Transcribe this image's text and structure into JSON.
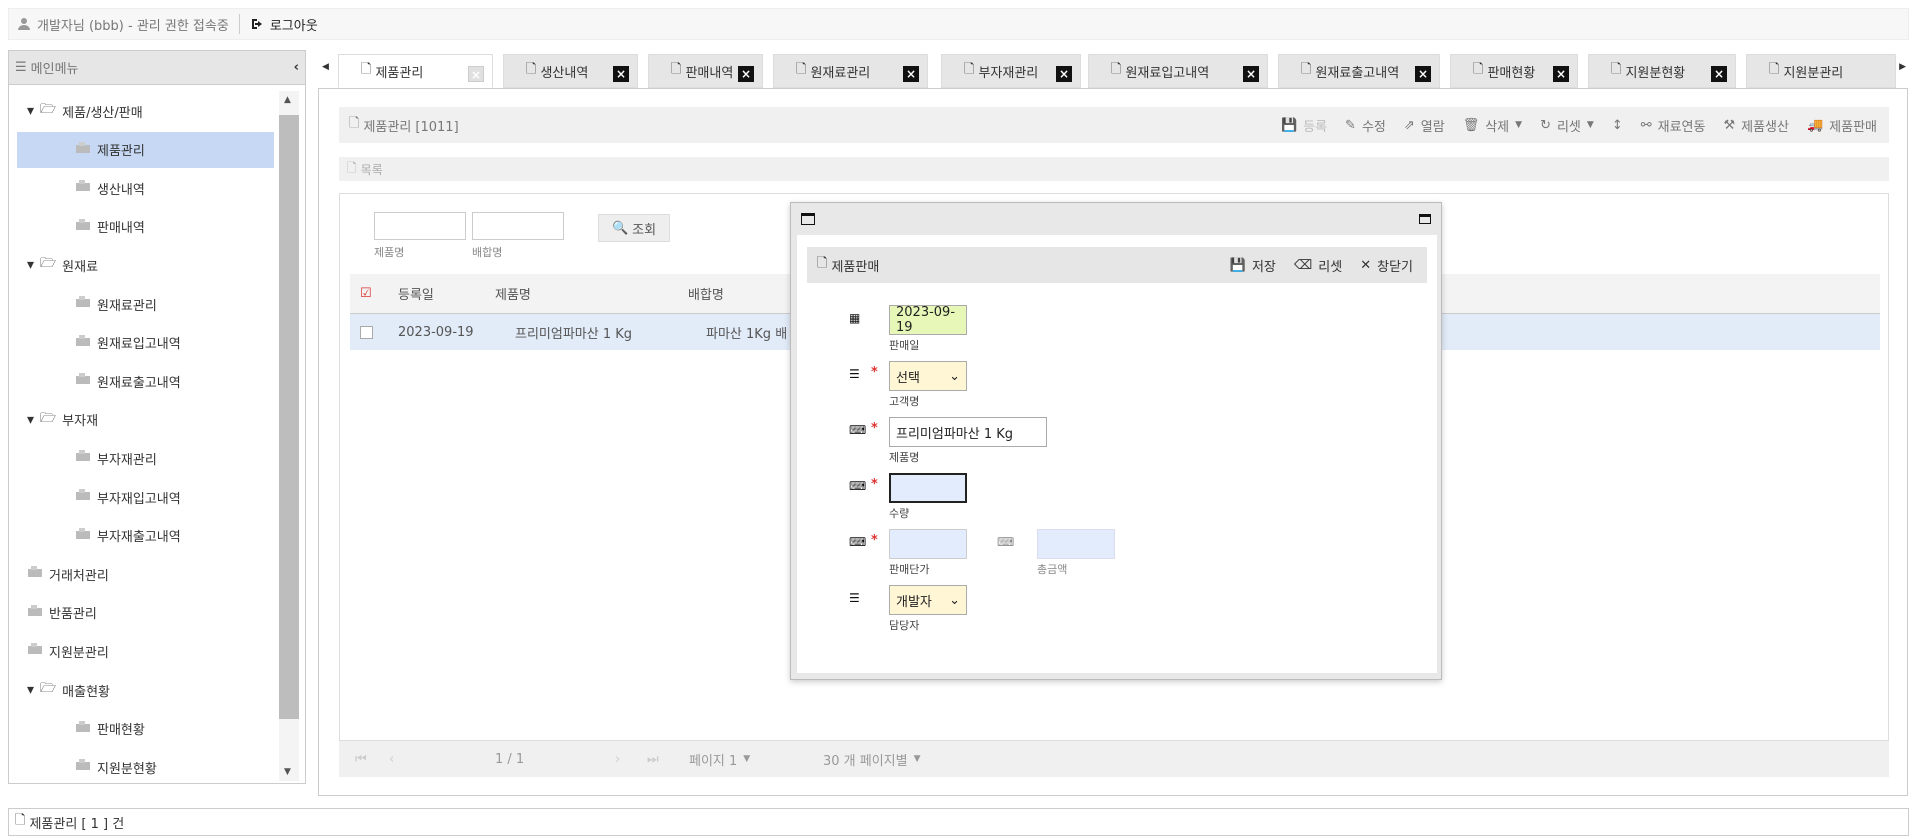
{
  "topbar": {
    "user_text": "개발자님 (bbb) - 관리 권한 접속중",
    "logout_label": "로그아웃"
  },
  "sidebar": {
    "title": "메인메뉴",
    "items": [
      {
        "label": "제품/생산/판매",
        "level": 0,
        "folder": true
      },
      {
        "label": "제품관리",
        "level": 1,
        "selected": true
      },
      {
        "label": "생산내역",
        "level": 1
      },
      {
        "label": "판매내역",
        "level": 1
      },
      {
        "label": "원재료",
        "level": 0,
        "folder": true
      },
      {
        "label": "원재료관리",
        "level": 1
      },
      {
        "label": "원재료입고내역",
        "level": 1
      },
      {
        "label": "원재료출고내역",
        "level": 1
      },
      {
        "label": "부자재",
        "level": 0,
        "folder": true
      },
      {
        "label": "부자재관리",
        "level": 1
      },
      {
        "label": "부자재입고내역",
        "level": 1
      },
      {
        "label": "부자재출고내역",
        "level": 1
      },
      {
        "label": "거래처관리",
        "level": 0
      },
      {
        "label": "반품관리",
        "level": 0
      },
      {
        "label": "지원분관리",
        "level": 0
      },
      {
        "label": "매출현황",
        "level": 0,
        "folder": true
      },
      {
        "label": "판매현황",
        "level": 1
      },
      {
        "label": "지원분현황",
        "level": 1
      }
    ]
  },
  "tabs": [
    {
      "label": "제품관리"
    },
    {
      "label": "생산내역"
    },
    {
      "label": "판매내역"
    },
    {
      "label": "원재료관리"
    },
    {
      "label": "부자재관리"
    },
    {
      "label": "원재료입고내역"
    },
    {
      "label": "원재료출고내역"
    },
    {
      "label": "판매현황"
    },
    {
      "label": "지원분현황"
    },
    {
      "label": "지원분관리"
    }
  ],
  "toolbar": {
    "title": "제품관리 [1011]",
    "buttons": {
      "register": "등록",
      "edit": "수정",
      "open": "열람",
      "delete": "삭제",
      "reset": "리셋",
      "material": "재료연동",
      "produce": "제품생산",
      "sell": "제품판매"
    }
  },
  "list": {
    "title": "목록"
  },
  "search": {
    "product_label": "제품명",
    "mix_label": "배합명",
    "button": "조회"
  },
  "grid": {
    "headers": {
      "date": "등록일",
      "product": "제품명",
      "mix": "배합명"
    },
    "rows": [
      {
        "date": "2023-09-19",
        "product": "프리미엄파마산 1 Kg",
        "mix": "파마산 1Kg 배"
      }
    ]
  },
  "pager": {
    "info": "1 / 1",
    "page": "페이지 1",
    "per_page": "30 개 페이지별"
  },
  "status": {
    "text": "제품관리 [ 1 ] 건"
  },
  "modal": {
    "title": "제품판매",
    "actions": {
      "save": "저장",
      "reset": "리셋",
      "close": "창닫기"
    },
    "fields": {
      "sale_date": {
        "value": "2023-09-19",
        "label": "판매일"
      },
      "customer": {
        "value": "선택",
        "label": "고객명"
      },
      "product": {
        "value": "프리미엄파마산 1 Kg",
        "label": "제품명"
      },
      "quantity": {
        "value": "",
        "label": "수량"
      },
      "unit_price": {
        "value": "",
        "label": "판매단가"
      },
      "total": {
        "value": "",
        "label": "총금액"
      },
      "manager": {
        "value": "개발자",
        "label": "담당자"
      }
    }
  },
  "colors": {
    "selected": "#c6d8f3",
    "date_field": "#e6f7b8",
    "select_field": "#fff6d6",
    "input_field": "#e3ecfc",
    "required": "#dd3333"
  }
}
